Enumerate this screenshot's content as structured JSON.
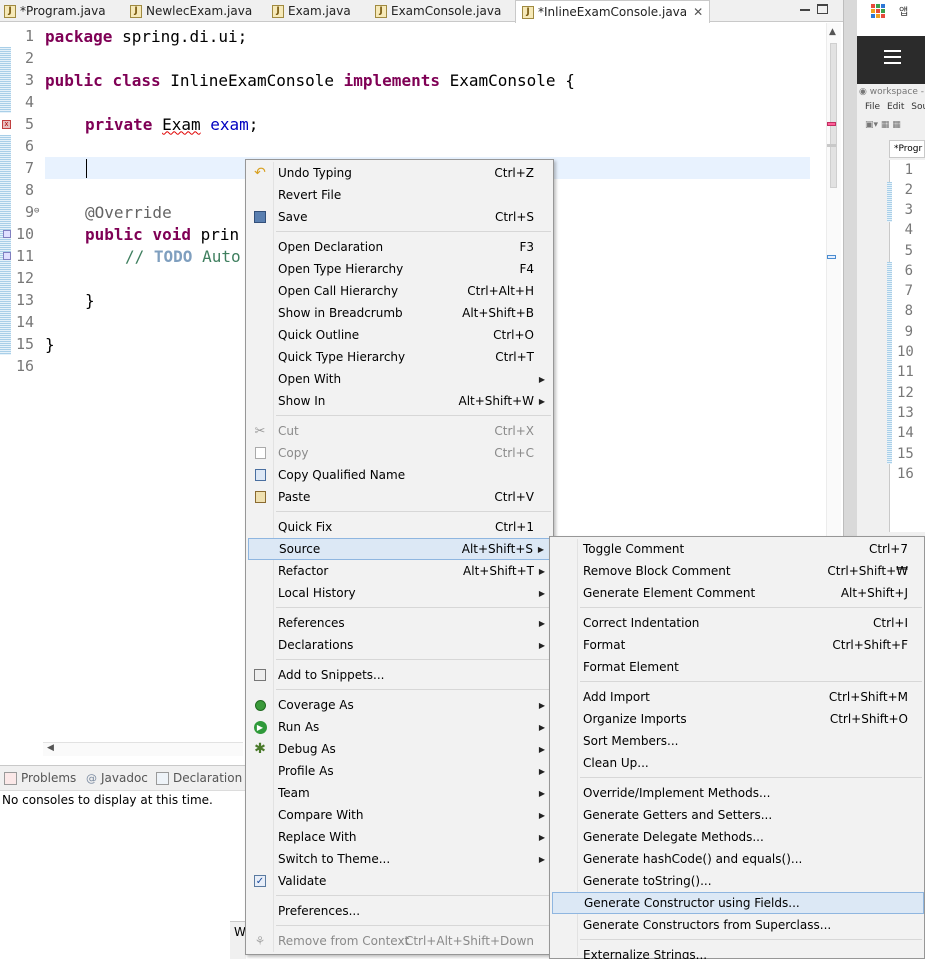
{
  "tabs": [
    {
      "label": "*Program.java",
      "active": false
    },
    {
      "label": "NewlecExam.java",
      "active": false
    },
    {
      "label": "Exam.java",
      "active": false
    },
    {
      "label": "ExamConsole.java",
      "active": false
    },
    {
      "label": "*InlineExamConsole.java",
      "active": true
    }
  ],
  "editor": {
    "lines": [
      {
        "n": "1"
      },
      {
        "n": "2"
      },
      {
        "n": "3"
      },
      {
        "n": "4"
      },
      {
        "n": "5"
      },
      {
        "n": "6"
      },
      {
        "n": "7"
      },
      {
        "n": "8"
      },
      {
        "n": "9"
      },
      {
        "n": "10"
      },
      {
        "n": "11"
      },
      {
        "n": "12"
      },
      {
        "n": "13"
      },
      {
        "n": "14"
      },
      {
        "n": "15"
      },
      {
        "n": "16"
      }
    ],
    "code": {
      "l1_kw": "package",
      "l1_rest": " spring.di.ui;",
      "l3_kw1": "public",
      "l3_kw2": "class",
      "l3_name": " InlineExamConsole ",
      "l3_kw3": "implements",
      "l3_rest": " ExamConsole {",
      "l5_kw": "private",
      "l5_type": "Exam",
      "l5_field": "exam",
      "l5_semi": ";",
      "l9_ann": "@Override",
      "l10_kw1": "public",
      "l10_kw2": "void",
      "l10_rest": " prin",
      "l11_cmt1": "// ",
      "l11_todo": "TODO",
      "l11_cmt2": " Auto",
      "l13": "}",
      "l15": "}"
    }
  },
  "bottom_panel": {
    "tabs": [
      "Problems",
      "Javadoc",
      "Declaration"
    ],
    "console_text": "No consoles to display at this time.",
    "status_fragment": "W"
  },
  "bg_window": {
    "title_fragment": "앱",
    "workspace_label": "workspace -",
    "menu_items": [
      "File",
      "Edit",
      "Sou"
    ],
    "tab_label": "*Progr",
    "line_numbers": [
      "1",
      "2",
      "3",
      "4",
      "5",
      "6",
      "7",
      "8",
      "9",
      "10",
      "11",
      "12",
      "13",
      "14",
      "15",
      "16"
    ]
  },
  "context_menu": {
    "items": [
      {
        "label": "Undo Typing",
        "accel": "Ctrl+Z",
        "icon": "undo-icon"
      },
      {
        "label": "Revert File",
        "accel": ""
      },
      {
        "label": "Save",
        "accel": "Ctrl+S",
        "icon": "save-icon"
      },
      {
        "label": "Open Declaration",
        "accel": "F3"
      },
      {
        "label": "Open Type Hierarchy",
        "accel": "F4"
      },
      {
        "label": "Open Call Hierarchy",
        "accel": "Ctrl+Alt+H"
      },
      {
        "label": "Show in Breadcrumb",
        "accel": "Alt+Shift+B"
      },
      {
        "label": "Quick Outline",
        "accel": "Ctrl+O"
      },
      {
        "label": "Quick Type Hierarchy",
        "accel": "Ctrl+T"
      },
      {
        "label": "Open With",
        "accel": "",
        "submenu": true
      },
      {
        "label": "Show In",
        "accel": "Alt+Shift+W",
        "submenu": true
      },
      {
        "label": "Cut",
        "accel": "Ctrl+X",
        "disabled": true,
        "icon": "cut-icon"
      },
      {
        "label": "Copy",
        "accel": "Ctrl+C",
        "disabled": true,
        "icon": "copy-icon"
      },
      {
        "label": "Copy Qualified Name",
        "accel": "",
        "icon": "copy-qualified-icon"
      },
      {
        "label": "Paste",
        "accel": "Ctrl+V",
        "icon": "paste-icon"
      },
      {
        "label": "Quick Fix",
        "accel": "Ctrl+1"
      },
      {
        "label": "Source",
        "accel": "Alt+Shift+S",
        "submenu": true,
        "highlighted": true
      },
      {
        "label": "Refactor",
        "accel": "Alt+Shift+T",
        "submenu": true
      },
      {
        "label": "Local History",
        "accel": "",
        "submenu": true
      },
      {
        "label": "References",
        "accel": "",
        "submenu": true
      },
      {
        "label": "Declarations",
        "accel": "",
        "submenu": true
      },
      {
        "label": "Add to Snippets...",
        "accel": "",
        "icon": "snippets-icon"
      },
      {
        "label": "Coverage As",
        "accel": "",
        "submenu": true,
        "icon": "coverage-icon"
      },
      {
        "label": "Run As",
        "accel": "",
        "submenu": true,
        "icon": "run-icon"
      },
      {
        "label": "Debug As",
        "accel": "",
        "submenu": true,
        "icon": "debug-icon"
      },
      {
        "label": "Profile As",
        "accel": "",
        "submenu": true
      },
      {
        "label": "Team",
        "accel": "",
        "submenu": true
      },
      {
        "label": "Compare With",
        "accel": "",
        "submenu": true
      },
      {
        "label": "Replace With",
        "accel": "",
        "submenu": true
      },
      {
        "label": "Switch to Theme...",
        "accel": "",
        "submenu": true
      },
      {
        "label": "Validate",
        "accel": "",
        "icon": "check-icon"
      },
      {
        "label": "Preferences...",
        "accel": ""
      },
      {
        "label": "Remove from Context",
        "accel": "Ctrl+Alt+Shift+Down",
        "disabled": true,
        "icon": "remove-context-icon"
      }
    ]
  },
  "source_submenu": {
    "items": [
      {
        "label": "Toggle Comment",
        "accel": "Ctrl+7"
      },
      {
        "label": "Remove Block Comment",
        "accel": "Ctrl+Shift+₩"
      },
      {
        "label": "Generate Element Comment",
        "accel": "Alt+Shift+J"
      },
      {
        "label": "Correct Indentation",
        "accel": "Ctrl+I"
      },
      {
        "label": "Format",
        "accel": "Ctrl+Shift+F"
      },
      {
        "label": "Format Element",
        "accel": ""
      },
      {
        "label": "Add Import",
        "accel": "Ctrl+Shift+M"
      },
      {
        "label": "Organize Imports",
        "accel": "Ctrl+Shift+O"
      },
      {
        "label": "Sort Members...",
        "accel": ""
      },
      {
        "label": "Clean Up...",
        "accel": ""
      },
      {
        "label": "Override/Implement Methods...",
        "accel": ""
      },
      {
        "label": "Generate Getters and Setters...",
        "accel": ""
      },
      {
        "label": "Generate Delegate Methods...",
        "accel": ""
      },
      {
        "label": "Generate hashCode() and equals()...",
        "accel": ""
      },
      {
        "label": "Generate toString()...",
        "accel": ""
      },
      {
        "label": "Generate Constructor using Fields...",
        "accel": "",
        "highlighted": true
      },
      {
        "label": "Generate Constructors from Superclass...",
        "accel": ""
      },
      {
        "label": "Externalize Strings...",
        "accel": ""
      }
    ]
  },
  "colors": {
    "keyword": "#7f0055",
    "field": "#0000c0",
    "annotation": "#646464",
    "comment": "#3f7f5f",
    "menu_highlight": "#dce8f5"
  }
}
